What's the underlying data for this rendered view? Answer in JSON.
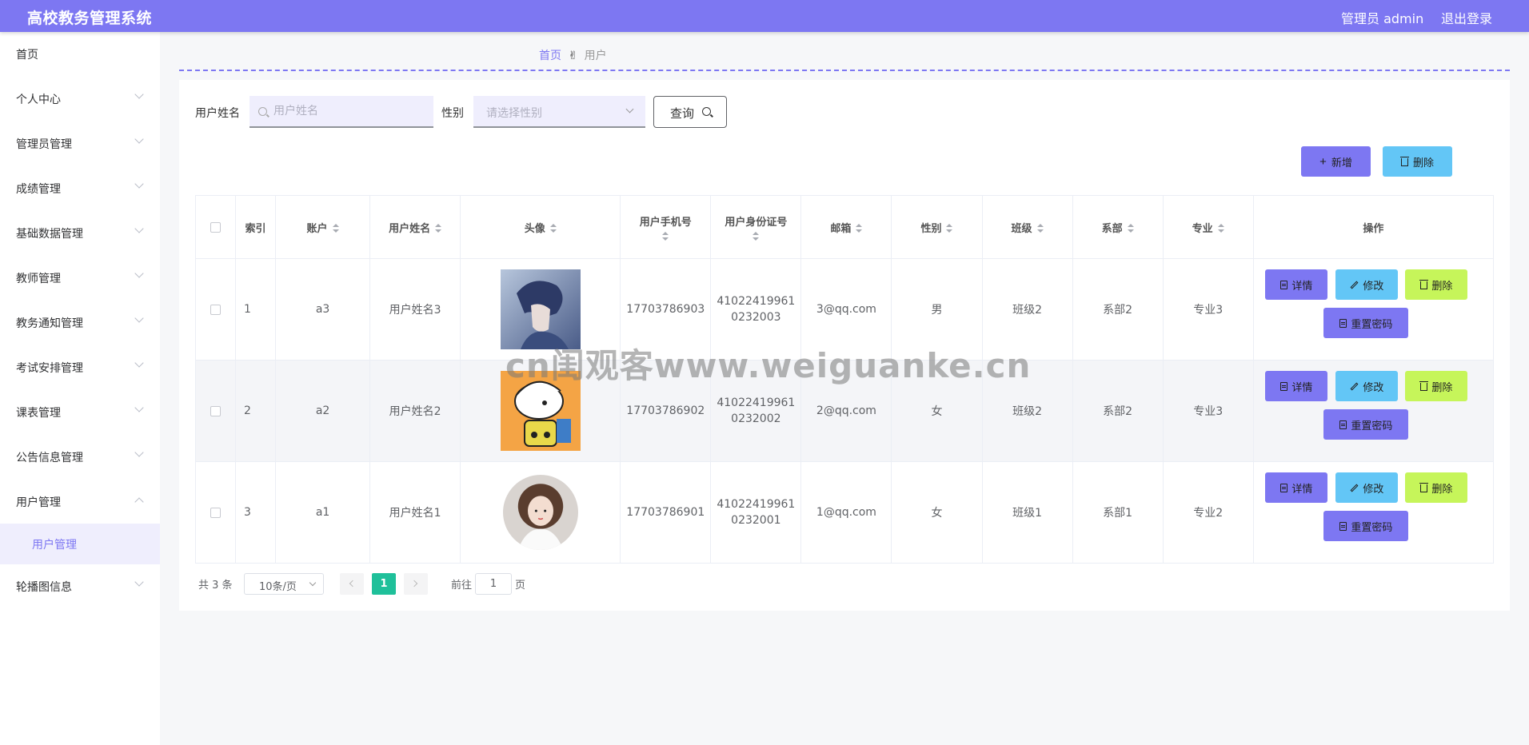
{
  "header": {
    "app_title": "高校教务管理系统",
    "admin_label": "管理员 admin",
    "logout": "退出登录",
    "accent": "#7d77f2"
  },
  "sidebar": {
    "items": [
      {
        "label": "首页",
        "expandable": false
      },
      {
        "label": "个人中心",
        "expandable": true
      },
      {
        "label": "管理员管理",
        "expandable": true
      },
      {
        "label": "成绩管理",
        "expandable": true
      },
      {
        "label": "基础数据管理",
        "expandable": true
      },
      {
        "label": "教师管理",
        "expandable": true
      },
      {
        "label": "教务通知管理",
        "expandable": true
      },
      {
        "label": "考试安排管理",
        "expandable": true
      },
      {
        "label": "课表管理",
        "expandable": true
      },
      {
        "label": "公告信息管理",
        "expandable": true
      },
      {
        "label": "用户管理",
        "expandable": true,
        "expanded": true
      },
      {
        "label": "轮播图信息",
        "expandable": true
      }
    ],
    "active_subitem": "用户管理"
  },
  "breadcrumb": {
    "home": "首页",
    "separator_icon": "hand-icon",
    "current": "用户"
  },
  "search": {
    "name_label": "用户姓名",
    "name_placeholder": "用户姓名",
    "name_value": "",
    "gender_label": "性别",
    "gender_placeholder": "请选择性别",
    "query_button": "查询"
  },
  "actions": {
    "add": "新增",
    "delete": "删除"
  },
  "table": {
    "columns": [
      "索引",
      "账户",
      "用户姓名",
      "头像",
      "用户手机号",
      "用户身份证号",
      "邮箱",
      "性别",
      "班级",
      "系部",
      "专业",
      "操作"
    ],
    "rows": [
      {
        "index": "1",
        "account": "a3",
        "name": "用户姓名3",
        "avatar": "avatar-anime-boy",
        "phone": "17703786903",
        "id_line1": "41022419961",
        "id_line2": "0232003",
        "email": "3@qq.com",
        "gender": "男",
        "class": "班级2",
        "dept": "系部2",
        "major": "专业3"
      },
      {
        "index": "2",
        "account": "a2",
        "name": "用户姓名2",
        "avatar": "avatar-cartoon-kid",
        "phone": "17703786902",
        "id_line1": "41022419961",
        "id_line2": "0232002",
        "email": "2@qq.com",
        "gender": "女",
        "class": "班级2",
        "dept": "系部2",
        "major": "专业3"
      },
      {
        "index": "3",
        "account": "a1",
        "name": "用户姓名1",
        "avatar": "avatar-illustrated-girl",
        "phone": "17703786901",
        "id_line1": "41022419961",
        "id_line2": "0232001",
        "email": "1@qq.com",
        "gender": "女",
        "class": "班级1",
        "dept": "系部1",
        "major": "专业2"
      }
    ],
    "row_actions": {
      "detail": "详情",
      "edit": "修改",
      "delete": "删除",
      "reset_password": "重置密码"
    }
  },
  "pagination": {
    "total": "共 3 条",
    "page_size": "10条/页",
    "current_page": "1",
    "goto_label": "前往",
    "goto_value": "1",
    "page_suffix": "页"
  },
  "watermark": "cn闺观客www.weiguanke.cn"
}
